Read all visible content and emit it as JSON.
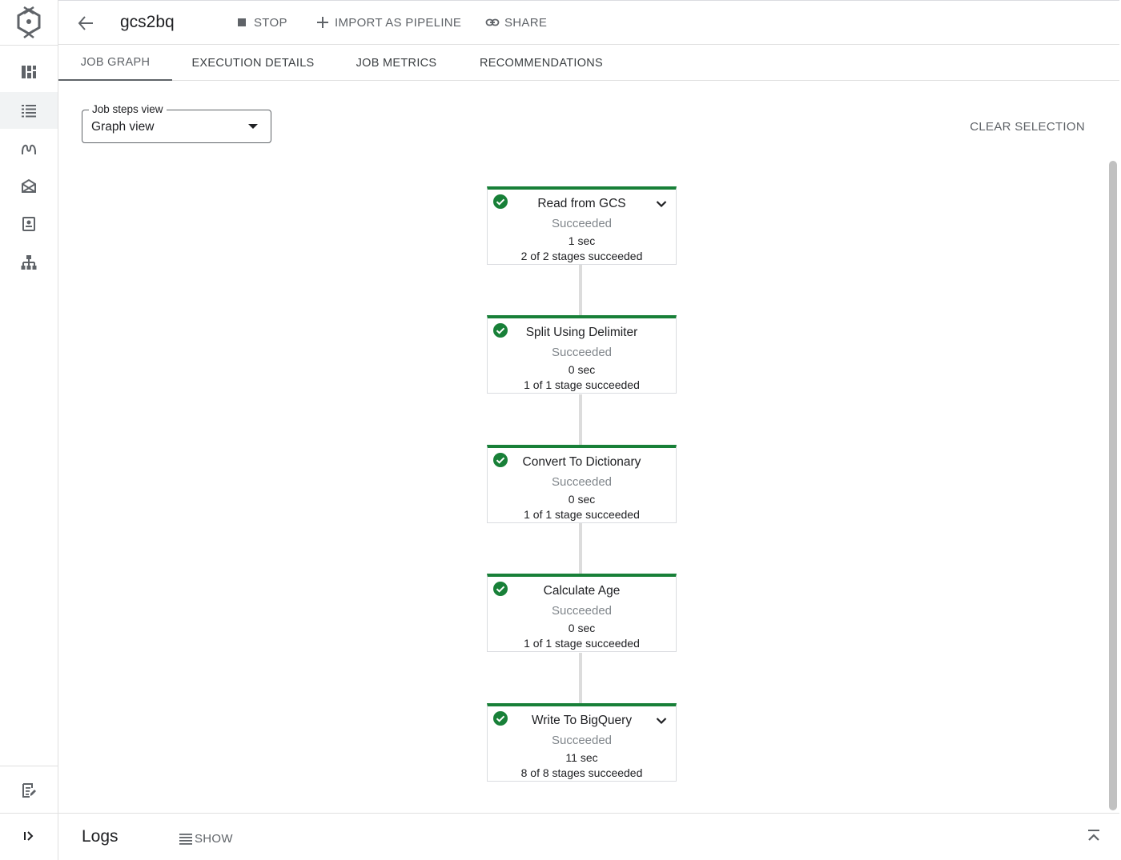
{
  "header": {
    "title": "gcs2bq",
    "stop_label": "STOP",
    "import_label": "IMPORT AS PIPELINE",
    "share_label": "SHARE"
  },
  "tabs": [
    {
      "label": "JOB GRAPH",
      "active": true
    },
    {
      "label": "EXECUTION DETAILS",
      "active": false
    },
    {
      "label": "JOB METRICS",
      "active": false
    },
    {
      "label": "RECOMMENDATIONS",
      "active": false
    }
  ],
  "view_select": {
    "label": "Job steps view",
    "value": "Graph view"
  },
  "clear_selection_label": "CLEAR SELECTION",
  "nodes": [
    {
      "title": "Read from GCS",
      "status": "Succeeded",
      "time": "1 sec",
      "stages": "2 of 2 stages succeeded",
      "expandable": true
    },
    {
      "title": "Split Using Delimiter",
      "status": "Succeeded",
      "time": "0 sec",
      "stages": "1 of 1 stage succeeded",
      "expandable": false
    },
    {
      "title": "Convert To Dictionary",
      "status": "Succeeded",
      "time": "0 sec",
      "stages": "1 of 1 stage succeeded",
      "expandable": false
    },
    {
      "title": "Calculate Age",
      "status": "Succeeded",
      "time": "0 sec",
      "stages": "1 of 1 stage succeeded",
      "expandable": false
    },
    {
      "title": "Write To BigQuery",
      "status": "Succeeded",
      "time": "11 sec",
      "stages": "8 of 8 stages succeeded",
      "expandable": true
    }
  ],
  "logs": {
    "title": "Logs",
    "show_label": "SHOW"
  },
  "colors": {
    "success": "#188038",
    "muted": "#5f6368"
  },
  "icons": [
    "dataflow-logo-icon",
    "dashboard-icon",
    "jobs-list-icon",
    "pipelines-icon",
    "workbench-icon",
    "notebooks-icon",
    "hierarchy-icon",
    "release-notes-icon",
    "expand-rail-icon"
  ]
}
